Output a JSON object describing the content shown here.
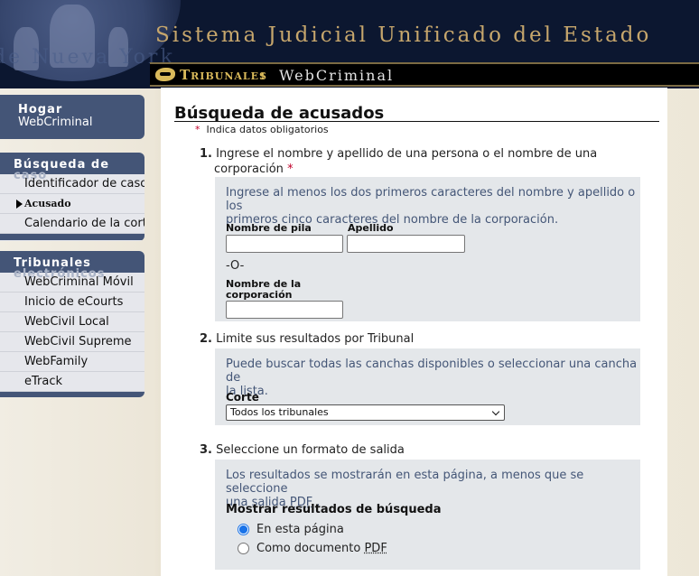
{
  "header": {
    "system_title": "Sistema Judicial Unificado del Estado",
    "watermark": "de Nueva York",
    "brand": "Tribunales",
    "brand_sep": ":",
    "app_name": "WebCriminal"
  },
  "sidebar": {
    "home": {
      "line1": "Hogar",
      "line2": "WebCriminal"
    },
    "search": {
      "heading": "Búsqueda de",
      "heading_overflow": "caso",
      "items": [
        {
          "label": "Identificador de caso"
        },
        {
          "label": "Acusado",
          "active": true
        },
        {
          "label": "Calendario de la corte"
        }
      ]
    },
    "courts": {
      "heading": "Tribunales",
      "heading_overflow": "electrónicos",
      "items": [
        {
          "label": "WebCriminal Móvil"
        },
        {
          "label": "Inicio de eCourts"
        },
        {
          "label": "WebCivil Local"
        },
        {
          "label": "WebCivil Supreme"
        },
        {
          "label": "WebFamily"
        },
        {
          "label": "eTrack"
        }
      ]
    }
  },
  "main": {
    "title": "Búsqueda de acusados",
    "required_mark": "*",
    "required_note": "Indica datos obligatorios",
    "step1": {
      "num": "1.",
      "text_line1": "Ingrese el nombre y apellido de una persona o el nombre de una",
      "text_line2": "corporación",
      "hint_line1": "Ingrese al menos los dos primeros caracteres del nombre y apellido o los",
      "hint_line2": "primeros cinco caracteres del nombre de la corporación.",
      "first_name_label": "Nombre de pila",
      "last_name_label": "Apellido",
      "first_name_value": "",
      "last_name_value": "",
      "or_text": "-O-",
      "corp_label_line1": "Nombre de la",
      "corp_label_line2": "corporación",
      "corp_value": ""
    },
    "step2": {
      "num": "2.",
      "text": "Limite sus resultados por Tribunal",
      "hint_line1": "Puede buscar todas las canchas disponibles o seleccionar una cancha de",
      "hint_line2": "la lista.",
      "court_label": "Corte",
      "court_selected": "Todos los tribunales"
    },
    "step3": {
      "num": "3.",
      "text": "Seleccione un formato de salida",
      "hint_line1": "Los resultados se mostrarán en esta página, a menos que se seleccione",
      "hint_line2_prefix": "una salida",
      "hint_line2_pdf": "PDF",
      "hint_line2_suffix": ".",
      "display_label": "Mostrar resultados de búsqueda",
      "option_page": "En esta página",
      "option_doc_prefix": "Como documento",
      "option_doc_pdf": "PDF",
      "selected": "En esta página"
    }
  }
}
